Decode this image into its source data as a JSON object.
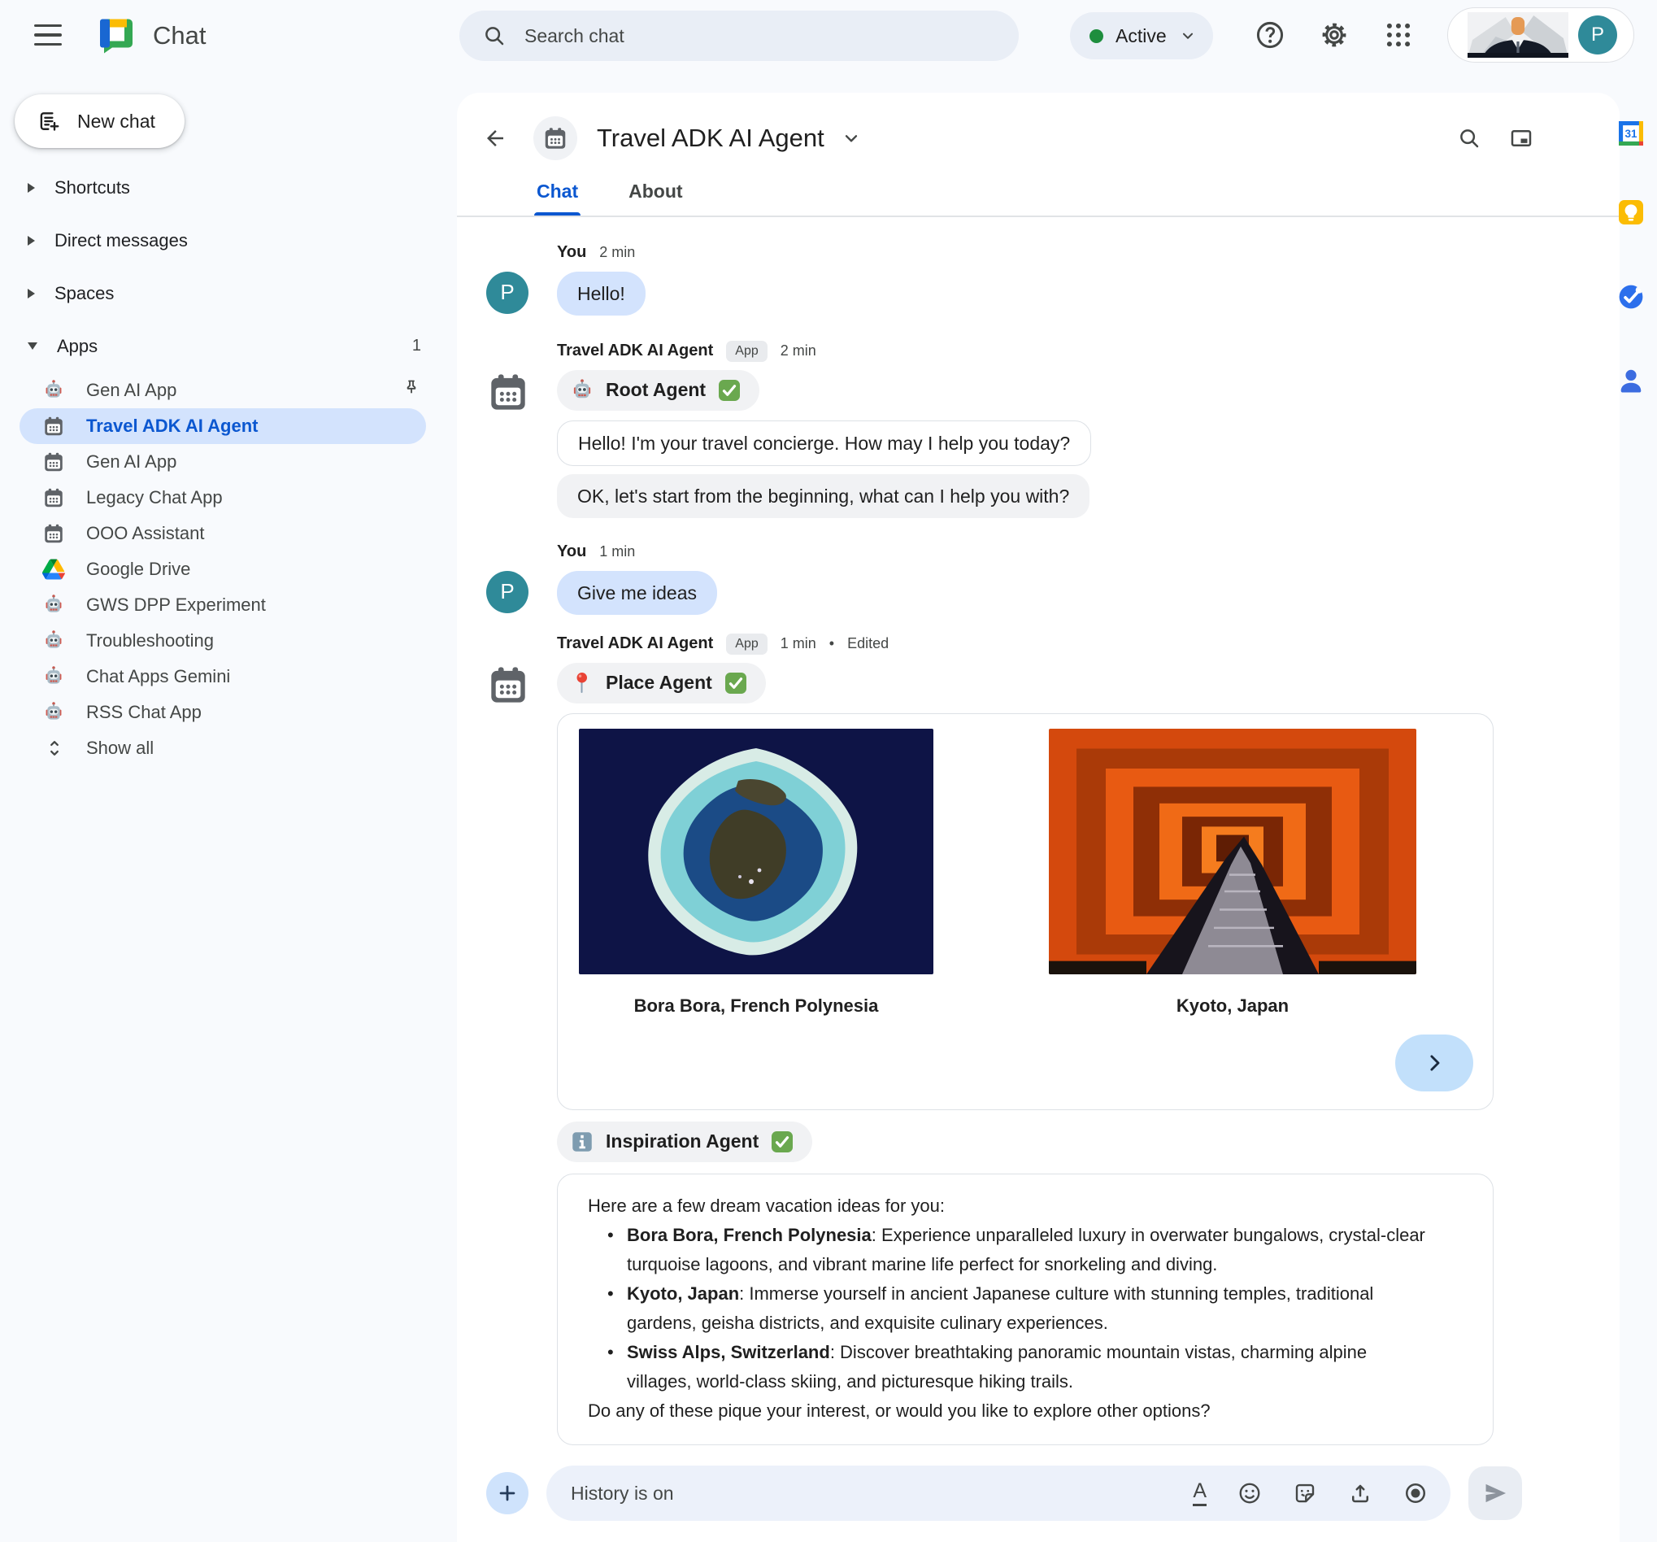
{
  "user": {
    "initial": "P"
  },
  "topbar": {
    "product": "Chat",
    "search_placeholder": "Search chat",
    "status": "Active"
  },
  "sidebar": {
    "new_chat": "New chat",
    "sections": [
      {
        "label": "Shortcuts"
      },
      {
        "label": "Direct messages"
      },
      {
        "label": "Spaces"
      },
      {
        "label": "Apps",
        "badge": "1"
      }
    ],
    "apps": [
      {
        "label": "Gen AI App"
      },
      {
        "label": "Travel ADK AI Agent"
      },
      {
        "label": "Gen AI App"
      },
      {
        "label": "Legacy Chat App"
      },
      {
        "label": "OOO Assistant"
      },
      {
        "label": "Google Drive"
      },
      {
        "label": "GWS DPP Experiment"
      },
      {
        "label": "Troubleshooting"
      },
      {
        "label": "Chat Apps Gemini"
      },
      {
        "label": "RSS Chat App"
      }
    ],
    "show_all": "Show all"
  },
  "chat": {
    "title": "Travel ADK AI Agent",
    "tabs": [
      "Chat",
      "About"
    ]
  },
  "messages": {
    "m1": {
      "author": "You",
      "time": "2 min",
      "text": "Hello!"
    },
    "m2": {
      "author": "Travel ADK AI Agent",
      "chip": "App",
      "time": "2 min",
      "agent": "Root Agent",
      "bubble1": "Hello! I'm your travel concierge. How may I help you today?",
      "bubble2": "OK, let's start from the beginning, what can I help you with?"
    },
    "m3": {
      "author": "You",
      "time": "1 min",
      "text": "Give me ideas"
    },
    "m4": {
      "author": "Travel ADK AI Agent",
      "chip": "App",
      "time": "1 min",
      "edited": "Edited",
      "agent": "Place Agent",
      "places": [
        {
          "caption": "Bora Bora, French Polynesia"
        },
        {
          "caption": "Kyoto, Japan"
        }
      ],
      "agent2": "Inspiration Agent",
      "ideas_intro": "Here are a few dream vacation ideas for you:",
      "ideas": [
        {
          "place": "Bora Bora, French Polynesia",
          "desc": ": Experience unparalleled luxury in overwater bungalows, crystal-clear turquoise lagoons, and vibrant marine life perfect for snorkeling and diving."
        },
        {
          "place": "Kyoto, Japan",
          "desc": ": Immerse yourself in ancient Japanese culture with stunning temples, traditional gardens, geisha districts, and exquisite culinary experiences."
        },
        {
          "place": "Swiss Alps, Switzerland",
          "desc": ": Discover breathtaking panoramic mountain vistas, charming alpine villages, world-class skiing, and picturesque hiking trails."
        }
      ],
      "ideas_outro": "Do any of these pique your interest, or would you like to explore other options?"
    }
  },
  "compose": {
    "placeholder": "History is on"
  },
  "colors": {
    "accent_blue": "#0b57d0",
    "selected_bg": "#d3e3fd",
    "user_bubble": "#d3e3fd",
    "active_dot": "#1e8e3e",
    "avatar_teal": "#2f8a99"
  }
}
